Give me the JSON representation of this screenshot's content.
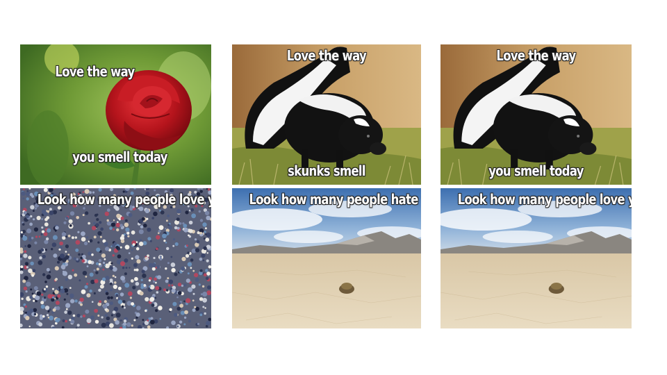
{
  "panels": [
    {
      "id": "rose",
      "subject": "rose",
      "top_text": "Love the way",
      "bottom_text": "you smell today"
    },
    {
      "id": "skunk-1",
      "subject": "skunk",
      "top_text": "Love the way",
      "bottom_text": "skunks smell"
    },
    {
      "id": "skunk-2",
      "subject": "skunk",
      "top_text": "Love the way",
      "bottom_text": "you smell today"
    },
    {
      "id": "crowd",
      "subject": "crowd",
      "top_text": "Look how many people love you"
    },
    {
      "id": "desert-1",
      "subject": "desert",
      "top_text": "Look how many people hate you"
    },
    {
      "id": "desert-2",
      "subject": "desert",
      "top_text": "Look how many people love you"
    }
  ]
}
